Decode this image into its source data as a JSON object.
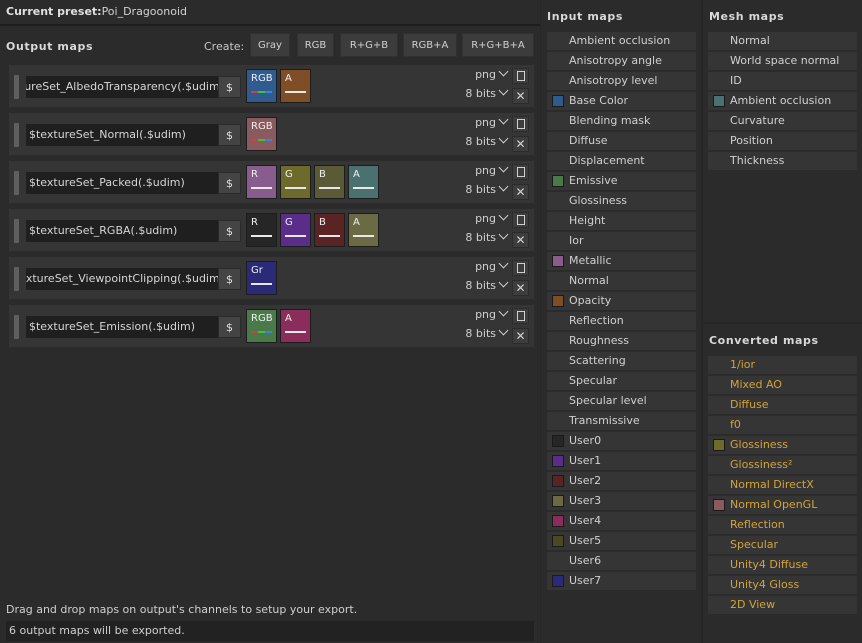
{
  "preset": {
    "label": "Current preset:",
    "value": "Poi_Dragoonoid"
  },
  "output": {
    "title": "Output maps",
    "create_label": "Create:",
    "create_buttons": [
      "Gray",
      "RGB",
      "R+G+B",
      "RGB+A",
      "R+G+B+A"
    ],
    "rows": [
      {
        "name": "$textureSet_AlbedoTransparency(.$udim)",
        "format": "png",
        "bits": "8 bits",
        "channels": [
          {
            "label": "RGB",
            "color": "#2f5b8e",
            "rgb": true
          },
          {
            "label": "A",
            "color": "#7f4e27"
          }
        ]
      },
      {
        "name": "$textureSet_Normal(.$udim)",
        "format": "png",
        "bits": "8 bits",
        "channels": [
          {
            "label": "RGB",
            "color": "#8a5a5f",
            "rgb": true
          }
        ]
      },
      {
        "name": "$textureSet_Packed(.$udim)",
        "format": "png",
        "bits": "8 bits",
        "channels": [
          {
            "label": "R",
            "color": "#885c8c"
          },
          {
            "label": "G",
            "color": "#6e6a2c"
          },
          {
            "label": "B",
            "color": "#5a5a36"
          },
          {
            "label": "A",
            "color": "#4a7070"
          }
        ]
      },
      {
        "name": "$textureSet_RGBA(.$udim)",
        "format": "png",
        "bits": "8 bits",
        "channels": [
          {
            "label": "R",
            "color": "#262626"
          },
          {
            "label": "G",
            "color": "#5a2d8a"
          },
          {
            "label": "B",
            "color": "#5a2424"
          },
          {
            "label": "A",
            "color": "#6a6a45"
          }
        ]
      },
      {
        "name": "$textureSet_ViewpointClipping(.$udim)",
        "format": "png",
        "bits": "8 bits",
        "channels": [
          {
            "label": "Gr",
            "color": "#2a2a78"
          }
        ]
      },
      {
        "name": "$textureSet_Emission(.$udim)",
        "format": "png",
        "bits": "8 bits",
        "channels": [
          {
            "label": "RGB",
            "color": "#4a7a4a",
            "rgb": true
          },
          {
            "label": "A",
            "color": "#8a2d5a"
          }
        ]
      }
    ],
    "hint": "Drag and drop maps on output's channels to setup your export.",
    "status": "6 output maps will be exported."
  },
  "input_maps": {
    "title": "Input maps",
    "items": [
      {
        "label": "Ambient occlusion"
      },
      {
        "label": "Anisotropy angle"
      },
      {
        "label": "Anisotropy level"
      },
      {
        "label": "Base Color",
        "color": "#2f5b8e"
      },
      {
        "label": "Blending mask"
      },
      {
        "label": "Diffuse"
      },
      {
        "label": "Displacement"
      },
      {
        "label": "Emissive",
        "color": "#4a7a4a"
      },
      {
        "label": "Glossiness"
      },
      {
        "label": "Height"
      },
      {
        "label": "Ior"
      },
      {
        "label": "Metallic",
        "color": "#885c8c"
      },
      {
        "label": "Normal"
      },
      {
        "label": "Opacity",
        "color": "#7f4e27"
      },
      {
        "label": "Reflection"
      },
      {
        "label": "Roughness"
      },
      {
        "label": "Scattering"
      },
      {
        "label": "Specular"
      },
      {
        "label": "Specular level"
      },
      {
        "label": "Transmissive"
      },
      {
        "label": "User0",
        "color": "#262626"
      },
      {
        "label": "User1",
        "color": "#5a2d8a"
      },
      {
        "label": "User2",
        "color": "#5a2424"
      },
      {
        "label": "User3",
        "color": "#6a6a45"
      },
      {
        "label": "User4",
        "color": "#8a2d5a"
      },
      {
        "label": "User5",
        "color": "#4a4a22"
      },
      {
        "label": "User6"
      },
      {
        "label": "User7",
        "color": "#2a2a78"
      }
    ]
  },
  "mesh_maps": {
    "title": "Mesh maps",
    "items": [
      {
        "label": "Normal"
      },
      {
        "label": "World space normal"
      },
      {
        "label": "ID"
      },
      {
        "label": "Ambient occlusion",
        "color": "#4a7070"
      },
      {
        "label": "Curvature"
      },
      {
        "label": "Position"
      },
      {
        "label": "Thickness"
      }
    ]
  },
  "converted_maps": {
    "title": "Converted maps",
    "items": [
      {
        "label": "1/ior"
      },
      {
        "label": "Mixed AO"
      },
      {
        "label": "Diffuse"
      },
      {
        "label": "f0"
      },
      {
        "label": "Glossiness",
        "color": "#6e6a2c"
      },
      {
        "label": "Glossiness²"
      },
      {
        "label": "Normal DirectX"
      },
      {
        "label": "Normal OpenGL",
        "color": "#8a5a5f"
      },
      {
        "label": "Reflection"
      },
      {
        "label": "Specular"
      },
      {
        "label": "Unity4 Diffuse"
      },
      {
        "label": "Unity4 Gloss"
      },
      {
        "label": "2D View"
      }
    ]
  }
}
